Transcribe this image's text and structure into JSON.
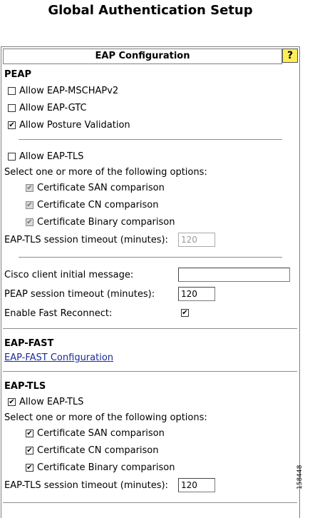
{
  "page_title": "Global Authentication Setup",
  "panel": {
    "header": "EAP Configuration",
    "help_glyph": "?"
  },
  "peap": {
    "title": "PEAP",
    "allow_mschapv2": {
      "label": "Allow EAP-MSCHAPv2",
      "checked": false
    },
    "allow_gtc": {
      "label": "Allow EAP-GTC",
      "checked": false
    },
    "allow_posture": {
      "label": "Allow Posture Validation",
      "checked": true
    },
    "allow_tls": {
      "label": "Allow EAP-TLS",
      "checked": false
    },
    "options_text": "Select one or more of the following options:",
    "cert_san": {
      "label": "Certificate SAN comparison",
      "checked": true,
      "disabled": true
    },
    "cert_cn": {
      "label": "Certificate CN comparison",
      "checked": true,
      "disabled": true
    },
    "cert_binary": {
      "label": "Certificate Binary comparison",
      "checked": true,
      "disabled": true
    },
    "tls_timeout_label": "EAP-TLS session timeout (minutes):",
    "tls_timeout_value": "120",
    "cisco_msg_label": "Cisco client initial message:",
    "cisco_msg_value": "",
    "peap_timeout_label": "PEAP session timeout (minutes):",
    "peap_timeout_value": "120",
    "fast_reconnect_label": "Enable Fast Reconnect:",
    "fast_reconnect_checked": true
  },
  "eap_fast": {
    "title": "EAP-FAST",
    "config_link": "EAP-FAST Configuration"
  },
  "eap_tls": {
    "title": "EAP-TLS",
    "allow_tls": {
      "label": "Allow EAP-TLS",
      "checked": true
    },
    "options_text": "Select one or more of the following options:",
    "cert_san": {
      "label": "Certificate SAN comparison",
      "checked": true
    },
    "cert_cn": {
      "label": "Certificate CN comparison",
      "checked": true
    },
    "cert_binary": {
      "label": "Certificate Binary comparison",
      "checked": true
    },
    "tls_timeout_label": "EAP-TLS session timeout (minutes):",
    "tls_timeout_value": "120"
  },
  "figure_number": "158448",
  "check_glyph": "✔"
}
